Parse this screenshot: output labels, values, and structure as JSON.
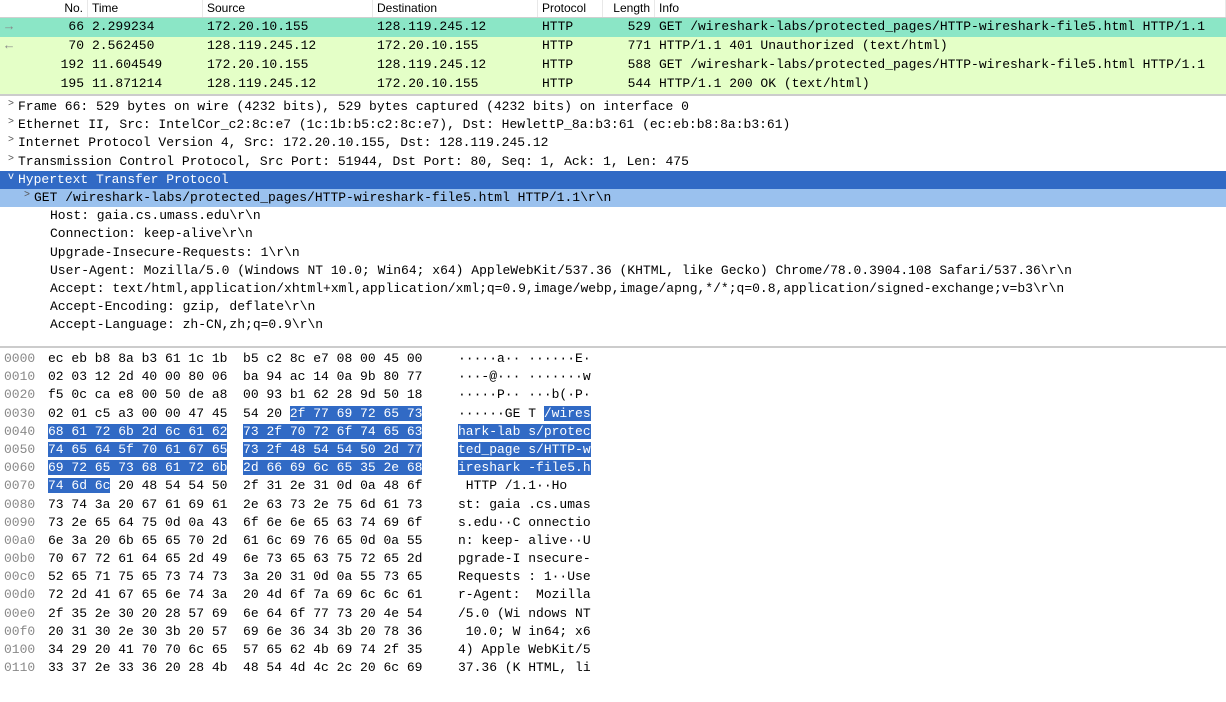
{
  "packet_list": {
    "columns": [
      "No.",
      "Time",
      "Source",
      "Destination",
      "Protocol",
      "Length",
      "Info"
    ],
    "rows": [
      {
        "arrow": "→",
        "no": "66",
        "time": "2.299234",
        "src": "172.20.10.155",
        "dst": "128.119.245.12",
        "proto": "HTTP",
        "len": "529",
        "info": "GET /wireshark-labs/protected_pages/HTTP-wireshark-file5.html HTTP/1.1",
        "sel": true
      },
      {
        "arrow": "←",
        "no": "70",
        "time": "2.562450",
        "src": "128.119.245.12",
        "dst": "172.20.10.155",
        "proto": "HTTP",
        "len": "771",
        "info": "HTTP/1.1 401 Unauthorized  (text/html)",
        "sel": false
      },
      {
        "arrow": "",
        "no": "192",
        "time": "11.604549",
        "src": "172.20.10.155",
        "dst": "128.119.245.12",
        "proto": "HTTP",
        "len": "588",
        "info": "GET /wireshark-labs/protected_pages/HTTP-wireshark-file5.html HTTP/1.1",
        "sel": false
      },
      {
        "arrow": "",
        "no": "195",
        "time": "11.871214",
        "src": "128.119.245.12",
        "dst": "172.20.10.155",
        "proto": "HTTP",
        "len": "544",
        "info": "HTTP/1.1 200 OK  (text/html)",
        "sel": false
      }
    ]
  },
  "details": {
    "lines": [
      {
        "depth": 1,
        "toggle": ">",
        "text": "Frame 66: 529 bytes on wire (4232 bits), 529 bytes captured (4232 bits) on interface 0"
      },
      {
        "depth": 1,
        "toggle": ">",
        "text": "Ethernet II, Src: IntelCor_c2:8c:e7 (1c:1b:b5:c2:8c:e7), Dst: HewlettP_8a:b3:61 (ec:eb:b8:8a:b3:61)"
      },
      {
        "depth": 1,
        "toggle": ">",
        "text": "Internet Protocol Version 4, Src: 172.20.10.155, Dst: 128.119.245.12"
      },
      {
        "depth": 1,
        "toggle": ">",
        "text": "Transmission Control Protocol, Src Port: 51944, Dst Port: 80, Seq: 1, Ack: 1, Len: 475"
      },
      {
        "depth": 1,
        "toggle": "v",
        "text": "Hypertext Transfer Protocol",
        "sel": 1
      },
      {
        "depth": 2,
        "toggle": ">",
        "text": "GET /wireshark-labs/protected_pages/HTTP-wireshark-file5.html HTTP/1.1\\r\\n",
        "sel": 2
      },
      {
        "depth": 3,
        "toggle": "",
        "text": "Host: gaia.cs.umass.edu\\r\\n"
      },
      {
        "depth": 3,
        "toggle": "",
        "text": "Connection: keep-alive\\r\\n"
      },
      {
        "depth": 3,
        "toggle": "",
        "text": "Upgrade-Insecure-Requests: 1\\r\\n"
      },
      {
        "depth": 3,
        "toggle": "",
        "text": "User-Agent: Mozilla/5.0 (Windows NT 10.0; Win64; x64) AppleWebKit/537.36 (KHTML, like Gecko) Chrome/78.0.3904.108 Safari/537.36\\r\\n"
      },
      {
        "depth": 3,
        "toggle": "",
        "text": "Accept: text/html,application/xhtml+xml,application/xml;q=0.9,image/webp,image/apng,*/*;q=0.8,application/signed-exchange;v=b3\\r\\n"
      },
      {
        "depth": 3,
        "toggle": "",
        "text": "Accept-Encoding: gzip, deflate\\r\\n"
      },
      {
        "depth": 3,
        "toggle": "",
        "text": "Accept-Language: zh-CN,zh;q=0.9\\r\\n"
      }
    ]
  },
  "hex": {
    "rows": [
      {
        "off": "0000",
        "b1": "ec eb b8 8a b3 61 1c 1b",
        "b2": "b5 c2 8c e7 08 00 45 00",
        "a": "·····a·· ······E·"
      },
      {
        "off": "0010",
        "b1": "02 03 12 2d 40 00 80 06",
        "b2": "ba 94 ac 14 0a 9b 80 77",
        "a": "···-@··· ·······w"
      },
      {
        "off": "0020",
        "b1": "f5 0c ca e8 00 50 de a8",
        "b2": "00 93 b1 62 28 9d 50 18",
        "a": "·····P·· ···b(·P·"
      },
      {
        "off": "0030",
        "b1": "02 01 c5 a3 00 00 47 45",
        "b2p": "54 20 ",
        "b2h": "2f 77 69 72 65 73",
        "a": "······GE T ",
        "ah": "/wires"
      },
      {
        "off": "0040",
        "b1h": "68 61 72 6b 2d 6c 61 62",
        "b2h": "73 2f 70 72 6f 74 65 63",
        "ah": "hark-lab s/protec"
      },
      {
        "off": "0050",
        "b1h": "74 65 64 5f 70 61 67 65",
        "b2h": "73 2f 48 54 54 50 2d 77",
        "ah": "ted_page s/HTTP-w"
      },
      {
        "off": "0060",
        "b1h": "69 72 65 73 68 61 72 6b",
        "b2h": "2d 66 69 6c 65 35 2e 68",
        "ah": "ireshark -file5.h"
      },
      {
        "off": "0070",
        "b1h": "74 6d 6c",
        "b1p": " 20 48 54 54 50",
        "b2": "2f 31 2e 31 0d 0a 48 6f",
        "ahp": "tml",
        "a": " HTTP /1.1··Ho"
      },
      {
        "off": "0080",
        "b1": "73 74 3a 20 67 61 69 61",
        "b2": "2e 63 73 2e 75 6d 61 73",
        "a": "st: gaia .cs.umas"
      },
      {
        "off": "0090",
        "b1": "73 2e 65 64 75 0d 0a 43",
        "b2": "6f 6e 6e 65 63 74 69 6f",
        "a": "s.edu··C onnectio"
      },
      {
        "off": "00a0",
        "b1": "6e 3a 20 6b 65 65 70 2d",
        "b2": "61 6c 69 76 65 0d 0a 55",
        "a": "n: keep- alive··U"
      },
      {
        "off": "00b0",
        "b1": "70 67 72 61 64 65 2d 49",
        "b2": "6e 73 65 63 75 72 65 2d",
        "a": "pgrade-I nsecure-"
      },
      {
        "off": "00c0",
        "b1": "52 65 71 75 65 73 74 73",
        "b2": "3a 20 31 0d 0a 55 73 65",
        "a": "Requests : 1··Use"
      },
      {
        "off": "00d0",
        "b1": "72 2d 41 67 65 6e 74 3a",
        "b2": "20 4d 6f 7a 69 6c 6c 61",
        "a": "r-Agent:  Mozilla"
      },
      {
        "off": "00e0",
        "b1": "2f 35 2e 30 20 28 57 69",
        "b2": "6e 64 6f 77 73 20 4e 54",
        "a": "/5.0 (Wi ndows NT"
      },
      {
        "off": "00f0",
        "b1": "20 31 30 2e 30 3b 20 57",
        "b2": "69 6e 36 34 3b 20 78 36",
        "a": " 10.0; W in64; x6"
      },
      {
        "off": "0100",
        "b1": "34 29 20 41 70 70 6c 65",
        "b2": "57 65 62 4b 69 74 2f 35",
        "a": "4) Apple WebKit/5"
      },
      {
        "off": "0110",
        "b1": "33 37 2e 33 36 20 28 4b",
        "b2": "48 54 4d 4c 2c 20 6c 69",
        "a": "37.36 (K HTML, li"
      }
    ]
  }
}
